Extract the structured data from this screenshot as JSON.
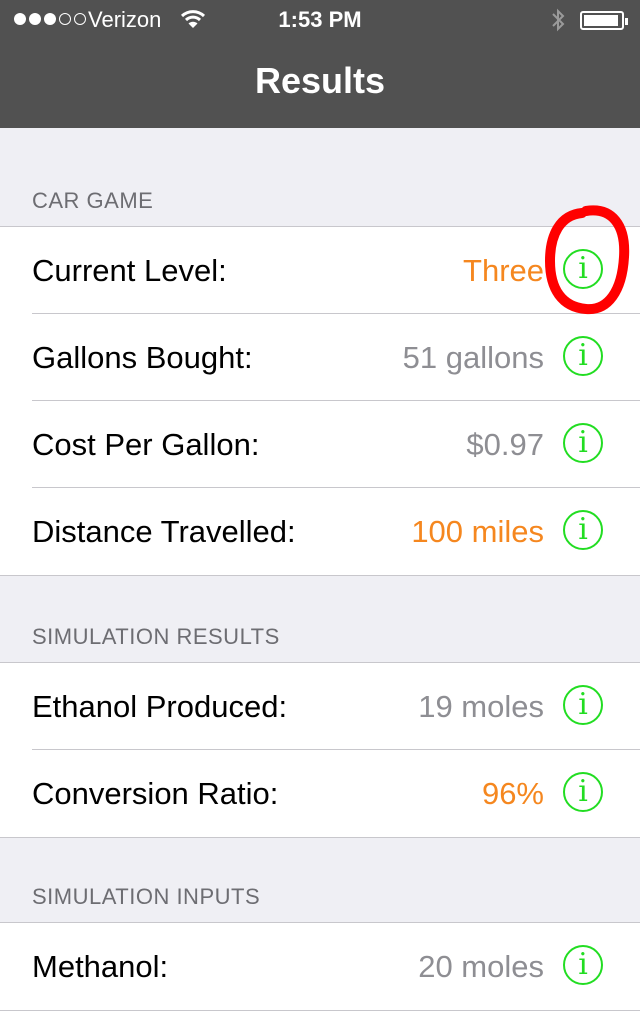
{
  "status_bar": {
    "carrier": "Verizon",
    "time": "1:53 PM",
    "signal_icon": "signal-dots-icon",
    "wifi_icon": "wifi-icon",
    "bluetooth_icon": "bluetooth-icon",
    "battery_icon": "battery-icon"
  },
  "nav": {
    "title": "Results"
  },
  "colors": {
    "orange": "#f5871f",
    "gray": "#8e8e93",
    "info_green": "#22dd22",
    "annotation_red": "#ff0000"
  },
  "sections": [
    {
      "header": "CAR GAME",
      "rows": [
        {
          "label": "Current Level:",
          "value": "Three",
          "value_color": "orange",
          "info": "i"
        },
        {
          "label": "Gallons Bought:",
          "value": "51 gallons",
          "value_color": "gray",
          "info": "i"
        },
        {
          "label": "Cost Per Gallon:",
          "value": "$0.97",
          "value_color": "gray",
          "info": "i"
        },
        {
          "label": "Distance Travelled:",
          "value": "100 miles",
          "value_color": "orange",
          "info": "i"
        }
      ]
    },
    {
      "header": "SIMULATION RESULTS",
      "rows": [
        {
          "label": "Ethanol Produced:",
          "value": "19 moles",
          "value_color": "gray",
          "info": "i"
        },
        {
          "label": "Conversion Ratio:",
          "value": "96%",
          "value_color": "orange",
          "info": "i"
        }
      ]
    },
    {
      "header": "SIMULATION INPUTS",
      "rows": [
        {
          "label": "Methanol:",
          "value": "20 moles",
          "value_color": "gray",
          "info": "i"
        }
      ]
    }
  ]
}
